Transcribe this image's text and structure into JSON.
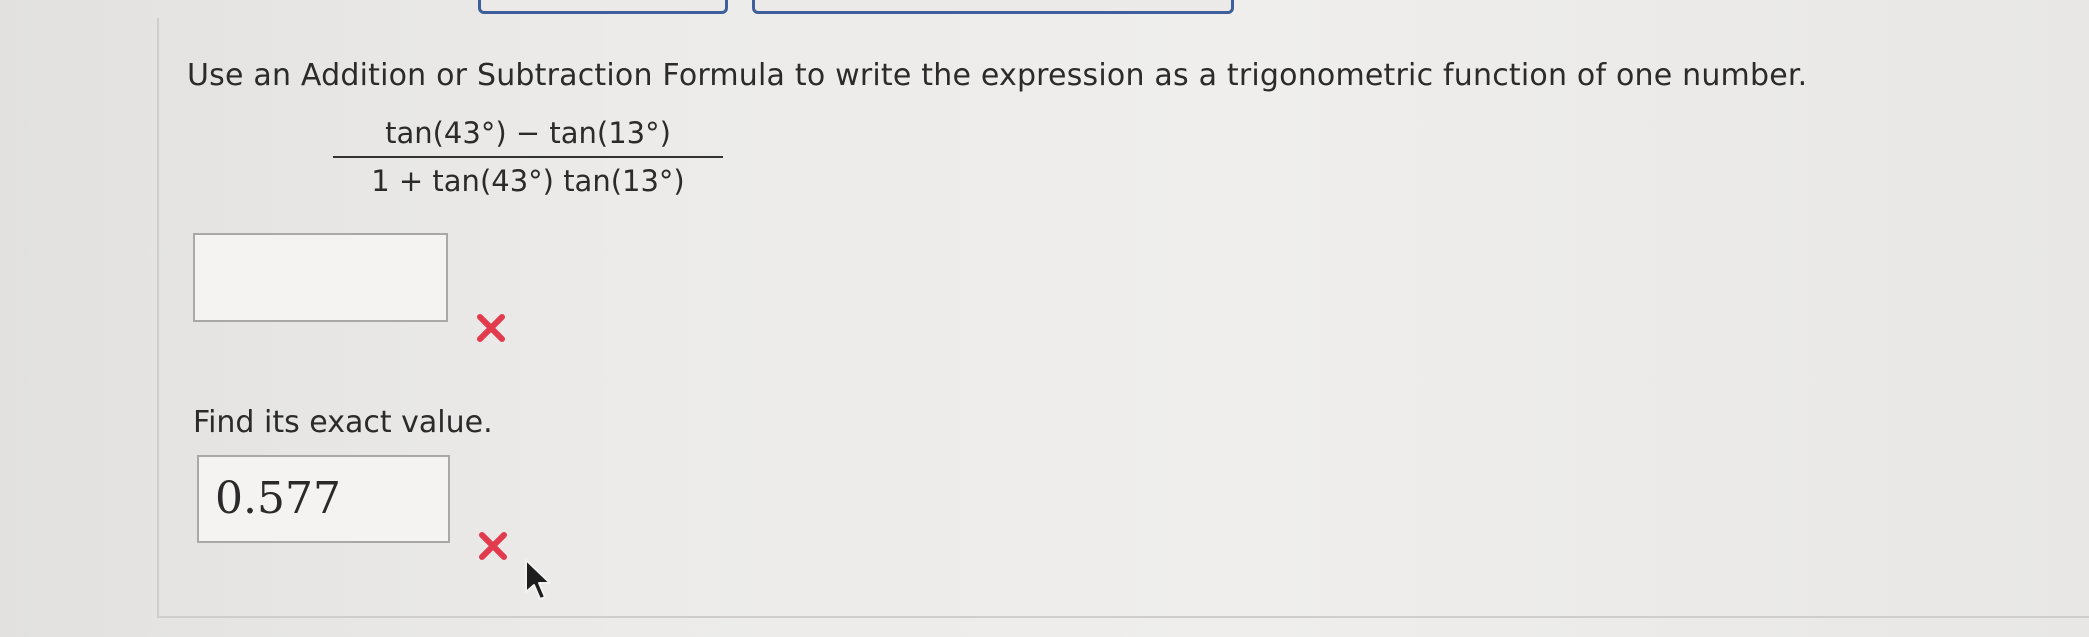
{
  "question": {
    "instruction": "Use an Addition or Subtraction Formula to write the expression as a trigonometric function of one number.",
    "numerator": "tan(43°) − tan(13°)",
    "denominator": "1 + tan(43°) tan(13°)"
  },
  "part1": {
    "answer_value": "",
    "status_icon": "incorrect-x-icon"
  },
  "part2": {
    "label": "Find its exact value.",
    "answer_value": "0.577",
    "status_icon": "incorrect-x-icon"
  },
  "colors": {
    "incorrect": "#e23b4e",
    "button_border": "#3d5f9c"
  }
}
